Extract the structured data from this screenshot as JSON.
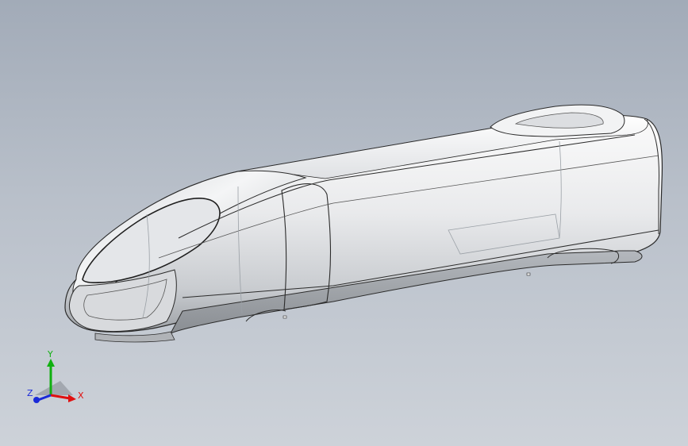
{
  "viewport": {
    "background_top": "#a2abb8",
    "background_bottom": "#cdd2d9",
    "model": {
      "name": "high-speed-train-nose-car",
      "body_color": "#e6e8ea",
      "edge_color": "#2b2b2b",
      "hidden_edge_color": "#9aa0a6"
    }
  },
  "triad": {
    "x_label": "X",
    "y_label": "Y",
    "z_label": "Z",
    "x_color": "#e01010",
    "y_color": "#10b010",
    "z_color": "#1a2ad8"
  }
}
